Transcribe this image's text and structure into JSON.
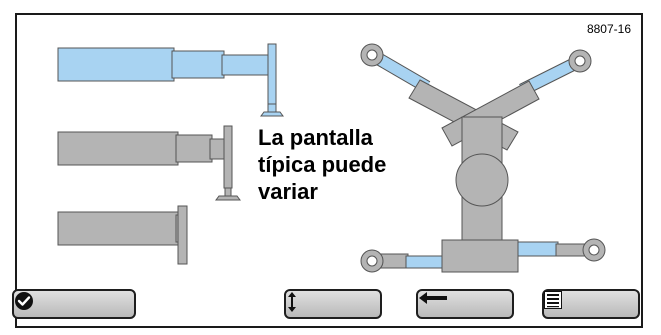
{
  "figure_id": "8807-16",
  "notice": "La pantalla\ntípica puede\nvariar",
  "colors": {
    "frame": "#1a1a1a",
    "blue_part": "#a8d3f2",
    "gray_part": "#b4b4b4",
    "outline": "#555555",
    "button_face": "#c8c8c8"
  },
  "buttons": [
    {
      "name": "confirm-button",
      "icon": "check-circle-icon"
    },
    {
      "name": "up-down-button",
      "icon": "up-down-arrow-icon"
    },
    {
      "name": "back-button",
      "icon": "left-arrow-icon"
    },
    {
      "name": "menu-button",
      "icon": "list-menu-icon"
    }
  ]
}
